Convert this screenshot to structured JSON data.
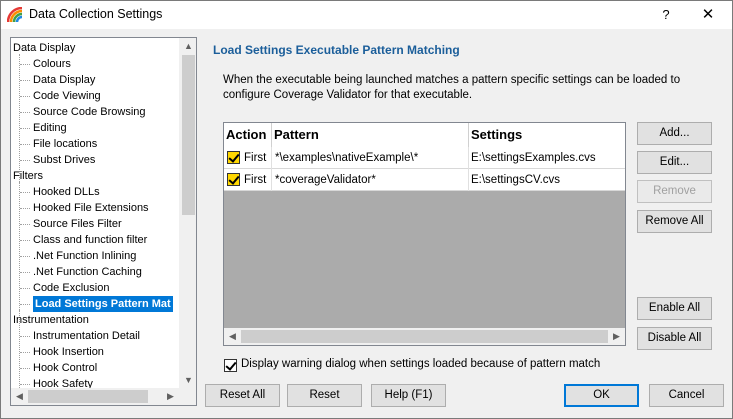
{
  "window": {
    "title": "Data Collection Settings",
    "help_glyph": "?",
    "close_glyph": "✕"
  },
  "tree": {
    "items": [
      {
        "label": "Data Display",
        "level": 0
      },
      {
        "label": "Colours",
        "level": 1
      },
      {
        "label": "Data Display",
        "level": 1
      },
      {
        "label": "Code Viewing",
        "level": 1
      },
      {
        "label": "Source Code Browsing",
        "level": 1
      },
      {
        "label": "Editing",
        "level": 1
      },
      {
        "label": "File locations",
        "level": 1
      },
      {
        "label": "Subst Drives",
        "level": 1
      },
      {
        "label": "Filters",
        "level": 0
      },
      {
        "label": "Hooked DLLs",
        "level": 1
      },
      {
        "label": "Hooked File Extensions",
        "level": 1
      },
      {
        "label": "Source Files Filter",
        "level": 1
      },
      {
        "label": "Class and function filter",
        "level": 1
      },
      {
        "label": ".Net Function Inlining",
        "level": 1
      },
      {
        "label": ".Net Function Caching",
        "level": 1
      },
      {
        "label": "Code Exclusion",
        "level": 1
      },
      {
        "label": "Load Settings Pattern Mat",
        "level": 1,
        "selected": true
      },
      {
        "label": "Instrumentation",
        "level": 0
      },
      {
        "label": "Instrumentation Detail",
        "level": 1
      },
      {
        "label": "Hook Insertion",
        "level": 1
      },
      {
        "label": "Hook Control",
        "level": 1
      },
      {
        "label": "Hook Safety",
        "level": 1
      }
    ],
    "scroll_up_glyph": "▲",
    "scroll_down_glyph": "▼",
    "scroll_left_glyph": "◀",
    "scroll_right_glyph": "▶"
  },
  "panel": {
    "heading": "Load Settings Executable Pattern Matching",
    "description": "When the executable being launched matches a pattern specific settings can be loaded to configure Coverage Validator for that executable."
  },
  "grid": {
    "columns": [
      "Action",
      "Pattern",
      "Settings"
    ],
    "rows": [
      {
        "checked": true,
        "action": "First",
        "pattern": "*\\examples\\nativeExample\\*",
        "settings": "E:\\settingsExamples.cvs"
      },
      {
        "checked": true,
        "action": "First",
        "pattern": "*coverageValidator*",
        "settings": "E:\\settingsCV.cvs"
      }
    ]
  },
  "buttons": {
    "add": "Add...",
    "edit": "Edit...",
    "remove": "Remove",
    "remove_all": "Remove All",
    "enable_all": "Enable All",
    "disable_all": "Disable All",
    "reset_all": "Reset All",
    "reset": "Reset",
    "help": "Help (F1)",
    "ok": "OK",
    "cancel": "Cancel"
  },
  "warning_checkbox": {
    "checked": true,
    "label": "Display warning dialog when settings loaded because of pattern match"
  },
  "colors": {
    "accent": "#0078d7",
    "heading": "#1b5e9a",
    "checkbox_highlight": "#ffd700"
  }
}
